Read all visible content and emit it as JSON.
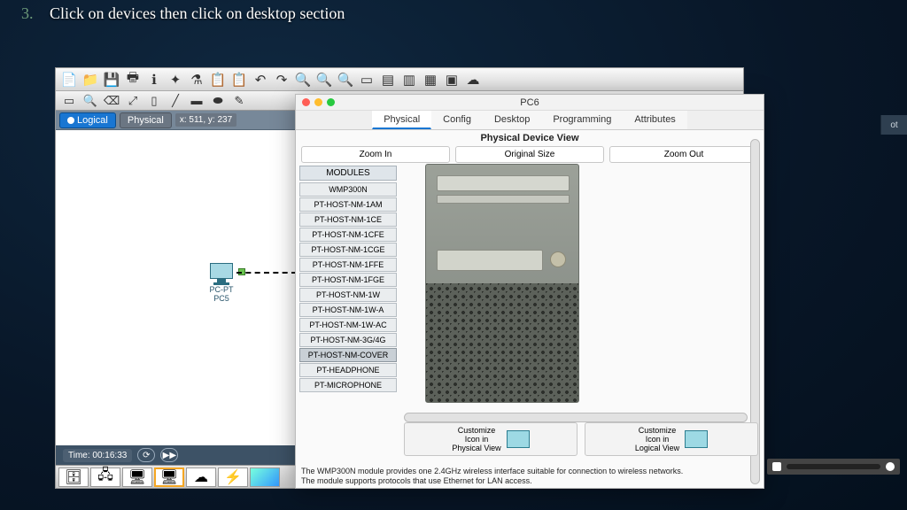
{
  "slide": {
    "number": "3.",
    "instruction": "Click on devices then click on desktop section"
  },
  "viewbar": {
    "logical": "Logical",
    "physical": "Physical",
    "coords": "x: 511, y: 237"
  },
  "device_on_canvas": {
    "type": "PC-PT",
    "name": "PC5"
  },
  "timebar": {
    "label": "Time: 00:16:33"
  },
  "modal": {
    "title": "PC6",
    "tabs": [
      "Physical",
      "Config",
      "Desktop",
      "Programming",
      "Attributes"
    ],
    "active_tab": "Physical",
    "subheader": "Physical Device View",
    "zoom": {
      "in": "Zoom In",
      "orig": "Original Size",
      "out": "Zoom Out"
    },
    "modules_header": "MODULES",
    "modules": [
      "WMP300N",
      "PT-HOST-NM-1AM",
      "PT-HOST-NM-1CE",
      "PT-HOST-NM-1CFE",
      "PT-HOST-NM-1CGE",
      "PT-HOST-NM-1FFE",
      "PT-HOST-NM-1FGE",
      "PT-HOST-NM-1W",
      "PT-HOST-NM-1W-A",
      "PT-HOST-NM-1W-AC",
      "PT-HOST-NM-3G/4G",
      "PT-HOST-NM-COVER",
      "PT-HEADPHONE",
      "PT-MICROPHONE"
    ],
    "selected_module": "PT-HOST-NM-COVER",
    "customize_physical": "Customize\nIcon in\nPhysical View",
    "customize_logical": "Customize\nIcon in\nLogical View",
    "description": "The WMP300N module provides one 2.4GHz wireless interface suitable for connection to wireless networks. The module supports protocols that use Ethernet for LAN access."
  },
  "root_right_label": "ot"
}
